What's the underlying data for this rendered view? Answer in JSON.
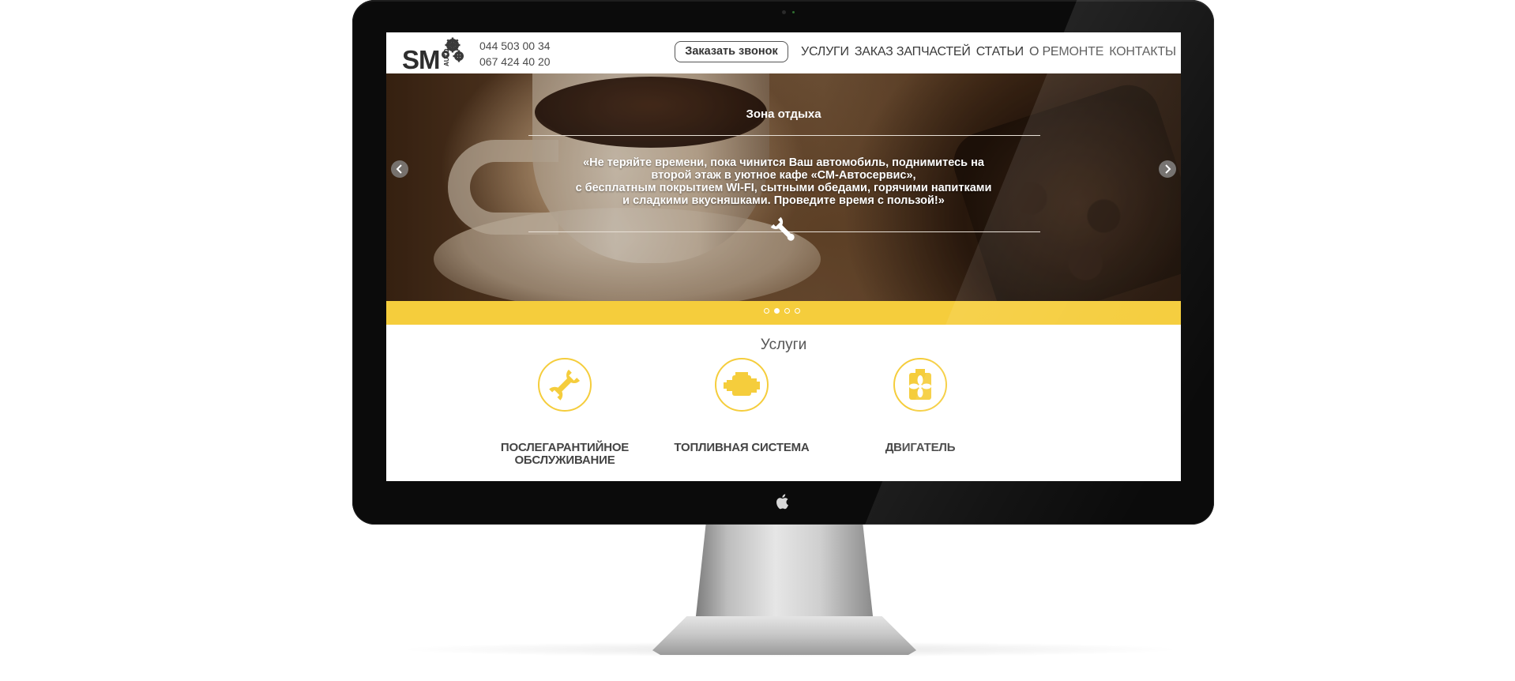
{
  "header": {
    "logo_text": "SM",
    "logo_sub": "AUTO",
    "phones": [
      "044 503 00 34",
      "067 424 40 20"
    ],
    "call_button": "Заказать звонок",
    "nav": [
      "УСЛУГИ",
      "ЗАКАЗ ЗАПЧАСТЕЙ",
      "СТАТЬИ",
      "О РЕМОНТЕ",
      "КОНТАКТЫ"
    ]
  },
  "slider": {
    "title": "Зона отдыха",
    "text_lines": [
      "«Не теряйте времени, пока чинится Ваш автомобиль, поднимитесь на",
      "второй этаж в уютное кафе «СМ-Автосервис»,",
      "с бесплатным покрытием WI-FI, сытными обедами, горячими напитками",
      "и сладкими вкусняшками. Проведите время с пользой!»"
    ],
    "slide_count": 4,
    "active_slide": 2
  },
  "services": {
    "title": "Услуги",
    "items": [
      {
        "label_lines": [
          "ПОСЛЕГАРАНТИЙНОЕ",
          "ОБСЛУЖИВАНИЕ"
        ],
        "icon": "wrench-icon"
      },
      {
        "label_lines": [
          "ТОПЛИВНАЯ СИСТЕМА"
        ],
        "icon": "engine-icon"
      },
      {
        "label_lines": [
          "ДВИГАТЕЛЬ"
        ],
        "icon": "radiator-fan-icon"
      }
    ]
  },
  "colors": {
    "accent": "#f5cd3c",
    "text_dark": "#444444",
    "bezel": "#0b0b0b"
  }
}
